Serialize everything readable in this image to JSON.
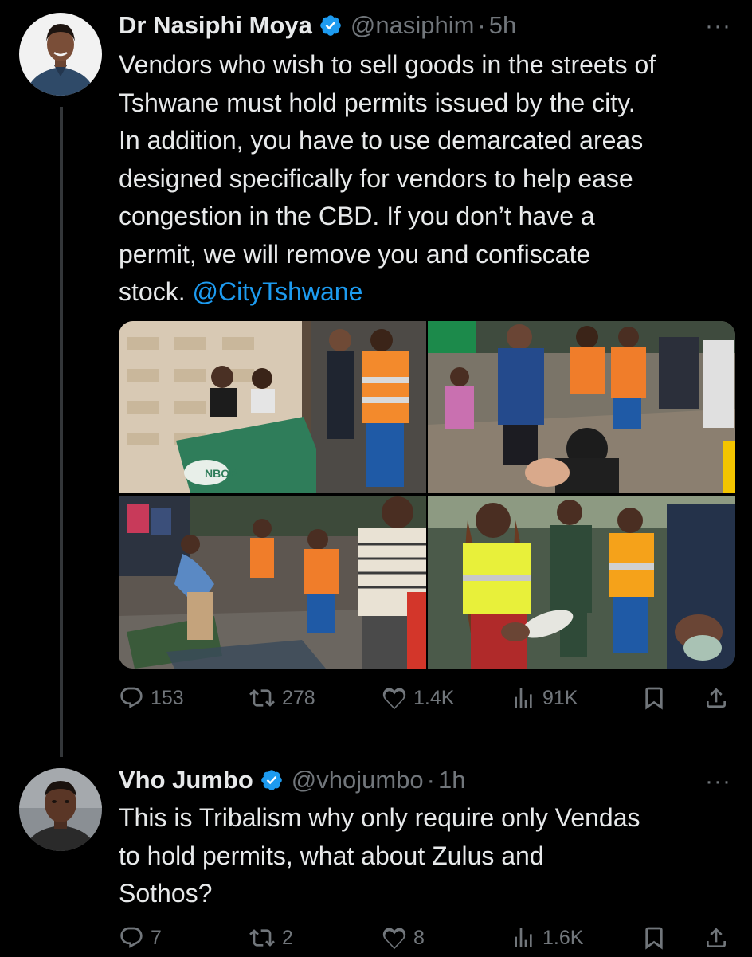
{
  "tweet1": {
    "display_name": "Dr Nasiphi Moya",
    "handle": "@nasiphim",
    "separator": "·",
    "time": "5h",
    "more": "···",
    "text": "Vendors who wish to sell goods in the streets of\nTshwane must hold permits issued by the city.\nIn addition, you have to use demarcated areas\ndesigned specifically for vendors to help ease\ncongestion in the CBD. If you don’t have a\npermit, we will remove you and confiscate\nstock. ",
    "mention": "@CityTshwane",
    "photos": [
      {
        "description": "Delta boxes and green NBOB table",
        "table_text": "NBOB"
      },
      {
        "description": "Officials and vendor in street"
      },
      {
        "description": "Officials at vendor goods"
      },
      {
        "description": "Official holding confiscated shoe"
      }
    ],
    "stats": {
      "replies": "153",
      "reposts": "278",
      "likes": "1.4K",
      "views": "91K"
    }
  },
  "tweet2": {
    "display_name": "Vho Jumbo",
    "handle": "@vhojumbo",
    "separator": "·",
    "time": "1h",
    "more": "···",
    "text": "This is Tribalism why only require only Vendas\nto hold permits, what about Zulus and\nSothos?",
    "stats": {
      "replies": "7",
      "reposts": "2",
      "likes": "8",
      "views": "1.6K"
    }
  },
  "colors": {
    "background": "#000000",
    "text": "#e7e9ea",
    "muted": "#71767b",
    "accent": "#1d9bf0",
    "verified": "#1d9bf0"
  },
  "icons": [
    "reply-icon",
    "repost-icon",
    "like-icon",
    "views-icon",
    "bookmark-icon",
    "share-icon",
    "verified-badge-icon",
    "more-icon"
  ]
}
